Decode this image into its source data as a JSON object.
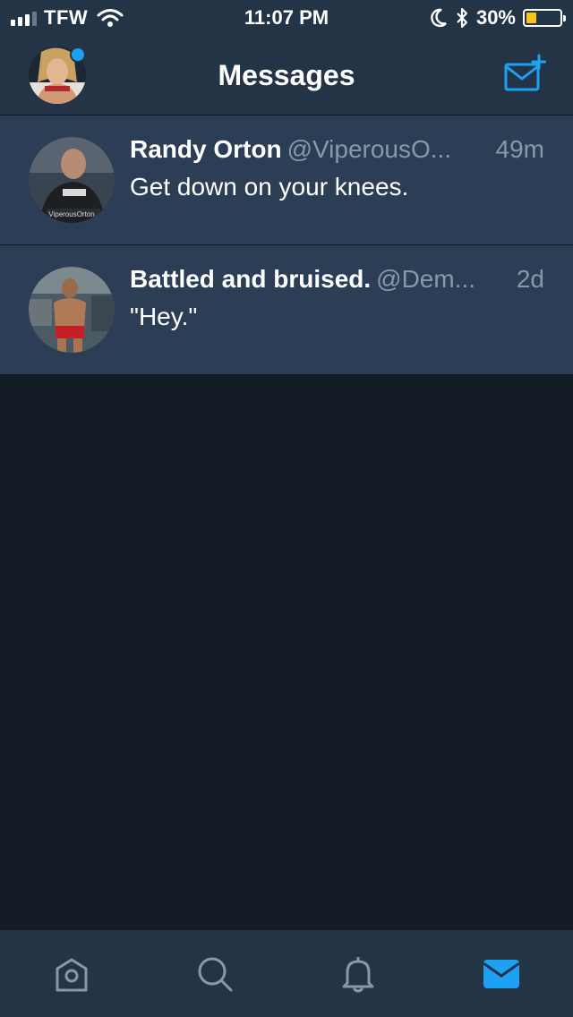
{
  "status_bar": {
    "carrier": "TFW",
    "time": "11:07 PM",
    "battery_percent": "30%",
    "battery_level": 0.3,
    "battery_color": "#f5c518",
    "icons": [
      "signal-icon",
      "wifi-icon",
      "moon-icon",
      "bluetooth-icon",
      "battery-icon"
    ]
  },
  "header": {
    "title": "Messages",
    "avatar_has_notification": true,
    "compose_icon": "compose-message-icon"
  },
  "conversations": [
    {
      "name": "Randy Orton",
      "handle": "@ViperousO...",
      "time": "49m",
      "message": "Get down on your knees.",
      "avatar_caption": "ViperousOrton"
    },
    {
      "name": "Battled and bruised.",
      "handle": "@Dem...",
      "time": "2d",
      "message": "\"Hey.\""
    }
  ],
  "tab_bar": {
    "tabs": [
      {
        "icon": "home-icon",
        "active": false
      },
      {
        "icon": "search-icon",
        "active": false
      },
      {
        "icon": "bell-icon",
        "active": false
      },
      {
        "icon": "mail-icon",
        "active": true
      }
    ]
  },
  "colors": {
    "accent": "#1da1f2",
    "bar_background": "#243447",
    "row_background": "#2c3e55",
    "page_background": "#141d26",
    "secondary_text": "#8899a6"
  }
}
